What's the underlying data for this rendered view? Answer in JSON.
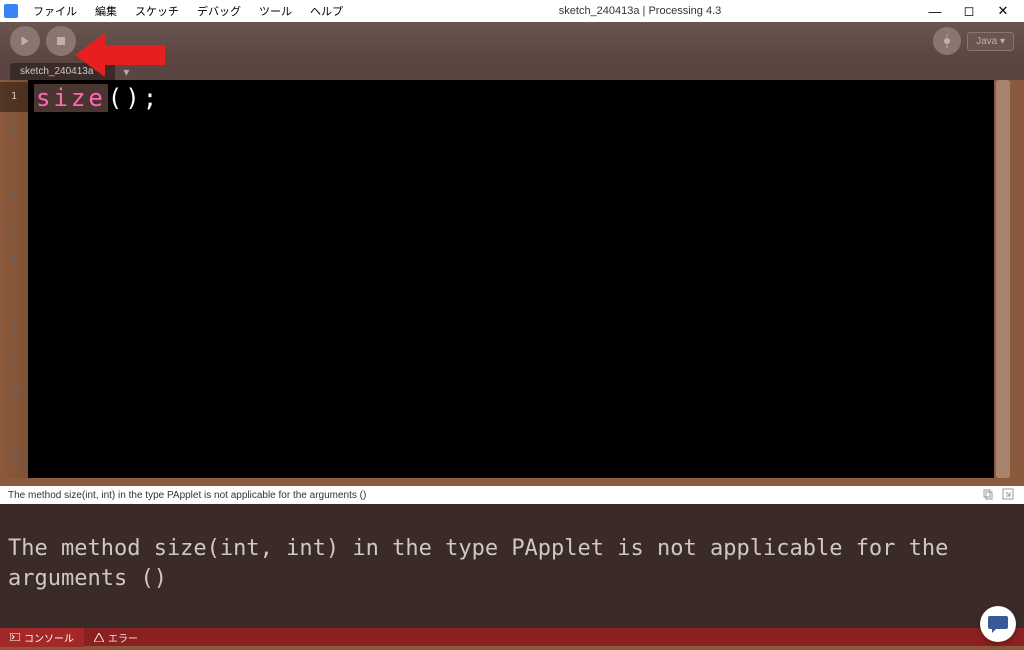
{
  "window": {
    "title": "sketch_240413a | Processing 4.3"
  },
  "menus": {
    "file": "ファイル",
    "edit": "編集",
    "sketch": "スケッチ",
    "debug": "デバッグ",
    "tool": "ツール",
    "help": "ヘルプ"
  },
  "toolbar": {
    "mode": "Java ▾"
  },
  "tab": {
    "name": "sketch_240413a"
  },
  "editor": {
    "lines": [
      "1",
      "2",
      "3",
      "4",
      "5",
      "6",
      "7",
      "8",
      "9",
      "10",
      "11",
      "12"
    ],
    "code_keyword": "size",
    "code_rest": "();"
  },
  "error_bar": {
    "message": "The method size(int, int) in the type PApplet is not applicable for the arguments ()"
  },
  "console": {
    "output": "The method size(int, int) in the type PApplet is not applicable for the arguments ()"
  },
  "footer": {
    "console_tab": "コンソール",
    "error_tab": "エラー"
  }
}
